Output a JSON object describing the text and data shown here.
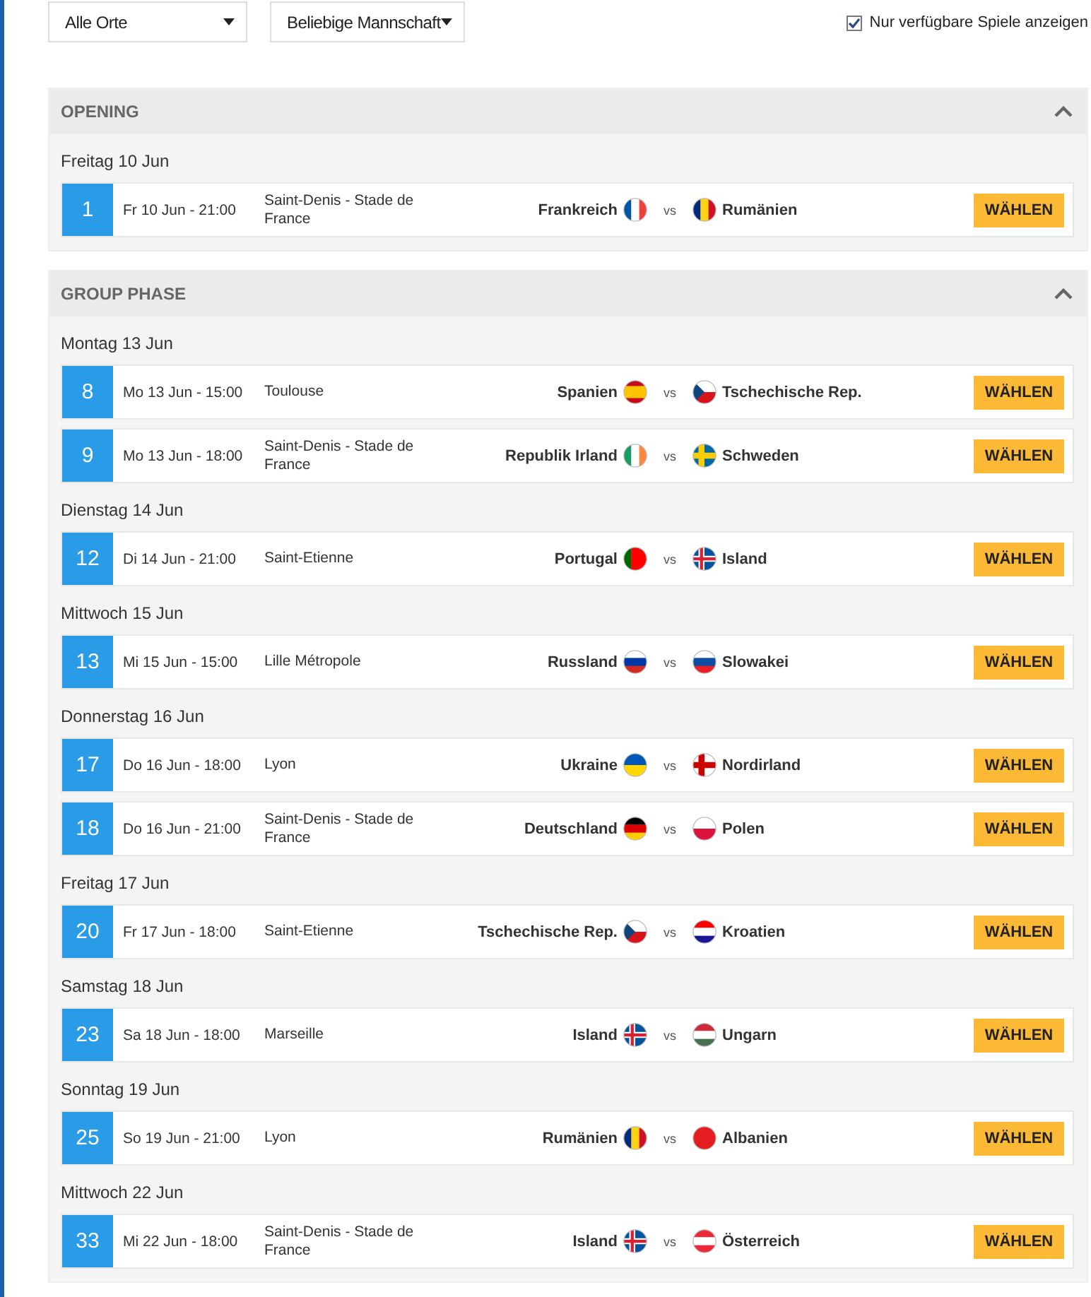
{
  "filters": {
    "dropdowns": [
      {
        "value": "Alle Orte"
      },
      {
        "value": "Beliebige Mannschaft"
      }
    ],
    "checkbox": {
      "label": "Nur verfügbare Spiele anzeigen",
      "checked": true
    }
  },
  "sections": [
    {
      "title": "OPENING",
      "expanded": true,
      "days": [
        {
          "label": "Freitag 10 Jun",
          "matches": [
            {
              "number": "1",
              "datetime": "Fr 10 Jun - 21:00",
              "venue": "Saint-Denis - Stade de France",
              "home": {
                "name": "Frankreich",
                "flag": {
                  "kind": "vertical",
                  "stripes": [
                    {
                      "color": "#0055a4"
                    },
                    {
                      "color": "#ffffff"
                    },
                    {
                      "color": "#ef4135"
                    }
                  ]
                }
              },
              "vs": "vs",
              "away": {
                "name": "Rumänien",
                "flag": {
                  "kind": "vertical",
                  "stripes": [
                    {
                      "color": "#002b7f"
                    },
                    {
                      "color": "#fcd116"
                    },
                    {
                      "color": "#ce1126"
                    }
                  ]
                }
              },
              "button": "WÄHLEN"
            }
          ]
        }
      ]
    },
    {
      "title": "GROUP PHASE",
      "expanded": true,
      "days": [
        {
          "label": "Montag 13 Jun",
          "matches": [
            {
              "number": "8",
              "datetime": "Mo 13 Jun - 15:00",
              "venue": "Toulouse",
              "home": {
                "name": "Spanien",
                "flag": {
                  "kind": "horizontal",
                  "stripes": [
                    {
                      "color": "#c60b1e"
                    },
                    {
                      "color": "#ffc400"
                    },
                    {
                      "color": "#ffc400"
                    },
                    {
                      "color": "#c60b1e"
                    }
                  ]
                }
              },
              "vs": "vs",
              "away": {
                "name": "Tschechische Rep.",
                "flag": {
                  "kind": "triangle",
                  "stripes": [
                    {
                      "color": "#ffffff"
                    },
                    {
                      "color": "#d7141a"
                    },
                    {
                      "color": "#11457e"
                    }
                  ]
                }
              },
              "button": "WÄHLEN"
            },
            {
              "number": "9",
              "datetime": "Mo 13 Jun - 18:00",
              "venue": "Saint-Denis - Stade de France",
              "home": {
                "name": "Republik Irland",
                "flag": {
                  "kind": "vertical",
                  "stripes": [
                    {
                      "color": "#169b62"
                    },
                    {
                      "color": "#ffffff"
                    },
                    {
                      "color": "#ff883e"
                    }
                  ]
                }
              },
              "vs": "vs",
              "away": {
                "name": "Schweden",
                "flag": {
                  "kind": "cross",
                  "stripes": [
                    {
                      "color": "#006aa7"
                    },
                    {
                      "color": "#fecc00"
                    },
                    {
                      "color": "#fecc00"
                    }
                  ]
                }
              },
              "button": "WÄHLEN"
            }
          ]
        },
        {
          "label": "Dienstag 14 Jun",
          "matches": [
            {
              "number": "12",
              "datetime": "Di 14 Jun - 21:00",
              "venue": "Saint-Etienne",
              "home": {
                "name": "Portugal",
                "flag": {
                  "kind": "vertical",
                  "stripes": [
                    {
                      "color": "#006600"
                    },
                    {
                      "color": "#ff0000"
                    },
                    {
                      "color": "#ff0000"
                    }
                  ]
                }
              },
              "vs": "vs",
              "away": {
                "name": "Island",
                "flag": {
                  "kind": "cross",
                  "stripes": [
                    {
                      "color": "#02529c"
                    },
                    {
                      "color": "#ffffff"
                    },
                    {
                      "color": "#dc1e35"
                    }
                  ]
                }
              },
              "button": "WÄHLEN"
            }
          ]
        },
        {
          "label": "Mittwoch 15 Jun",
          "matches": [
            {
              "number": "13",
              "datetime": "Mi 15 Jun - 15:00",
              "venue": "Lille Métropole",
              "home": {
                "name": "Russland",
                "flag": {
                  "kind": "horizontal",
                  "stripes": [
                    {
                      "color": "#ffffff"
                    },
                    {
                      "color": "#0039a6"
                    },
                    {
                      "color": "#d52b1e"
                    }
                  ]
                }
              },
              "vs": "vs",
              "away": {
                "name": "Slowakei",
                "flag": {
                  "kind": "horizontal",
                  "stripes": [
                    {
                      "color": "#ffffff"
                    },
                    {
                      "color": "#0b4ea2"
                    },
                    {
                      "color": "#ee1c25"
                    }
                  ]
                }
              },
              "button": "WÄHLEN"
            }
          ]
        },
        {
          "label": "Donnerstag 16 Jun",
          "matches": [
            {
              "number": "17",
              "datetime": "Do 16 Jun - 18:00",
              "venue": "Lyon",
              "home": {
                "name": "Ukraine",
                "flag": {
                  "kind": "horizontal",
                  "stripes": [
                    {
                      "color": "#0057b7"
                    },
                    {
                      "color": "#ffd700"
                    }
                  ]
                }
              },
              "vs": "vs",
              "away": {
                "name": "Nordirland",
                "flag": {
                  "kind": "cross",
                  "stripes": [
                    {
                      "color": "#ffffff"
                    },
                    {
                      "color": "#cc0000"
                    },
                    {
                      "color": "#cc0000"
                    }
                  ]
                }
              },
              "button": "WÄHLEN"
            },
            {
              "number": "18",
              "datetime": "Do 16 Jun - 21:00",
              "venue": "Saint-Denis - Stade de France",
              "home": {
                "name": "Deutschland",
                "flag": {
                  "kind": "horizontal",
                  "stripes": [
                    {
                      "color": "#000000"
                    },
                    {
                      "color": "#dd0000"
                    },
                    {
                      "color": "#ffce00"
                    }
                  ]
                }
              },
              "vs": "vs",
              "away": {
                "name": "Polen",
                "flag": {
                  "kind": "horizontal",
                  "stripes": [
                    {
                      "color": "#ffffff"
                    },
                    {
                      "color": "#dc143c"
                    }
                  ]
                }
              },
              "button": "WÄHLEN"
            }
          ]
        },
        {
          "label": "Freitag 17 Jun",
          "matches": [
            {
              "number": "20",
              "datetime": "Fr 17 Jun - 18:00",
              "venue": "Saint-Etienne",
              "home": {
                "name": "Tschechische Rep.",
                "flag": {
                  "kind": "triangle",
                  "stripes": [
                    {
                      "color": "#ffffff"
                    },
                    {
                      "color": "#d7141a"
                    },
                    {
                      "color": "#11457e"
                    }
                  ]
                }
              },
              "vs": "vs",
              "away": {
                "name": "Kroatien",
                "flag": {
                  "kind": "horizontal",
                  "stripes": [
                    {
                      "color": "#ff0000"
                    },
                    {
                      "color": "#ffffff"
                    },
                    {
                      "color": "#171796"
                    }
                  ]
                }
              },
              "button": "WÄHLEN"
            }
          ]
        },
        {
          "label": "Samstag 18 Jun",
          "matches": [
            {
              "number": "23",
              "datetime": "Sa 18 Jun - 18:00",
              "venue": "Marseille",
              "home": {
                "name": "Island",
                "flag": {
                  "kind": "cross",
                  "stripes": [
                    {
                      "color": "#02529c"
                    },
                    {
                      "color": "#ffffff"
                    },
                    {
                      "color": "#dc1e35"
                    }
                  ]
                }
              },
              "vs": "vs",
              "away": {
                "name": "Ungarn",
                "flag": {
                  "kind": "horizontal",
                  "stripes": [
                    {
                      "color": "#ce2939"
                    },
                    {
                      "color": "#ffffff"
                    },
                    {
                      "color": "#477050"
                    }
                  ]
                }
              },
              "button": "WÄHLEN"
            }
          ]
        },
        {
          "label": "Sonntag 19 Jun",
          "matches": [
            {
              "number": "25",
              "datetime": "So 19 Jun - 21:00",
              "venue": "Lyon",
              "home": {
                "name": "Rumänien",
                "flag": {
                  "kind": "vertical",
                  "stripes": [
                    {
                      "color": "#002b7f"
                    },
                    {
                      "color": "#fcd116"
                    },
                    {
                      "color": "#ce1126"
                    }
                  ]
                }
              },
              "vs": "vs",
              "away": {
                "name": "Albanien",
                "flag": {
                  "kind": "horizontal",
                  "stripes": [
                    {
                      "color": "#e41e20"
                    }
                  ]
                }
              },
              "button": "WÄHLEN"
            }
          ]
        },
        {
          "label": "Mittwoch 22 Jun",
          "matches": [
            {
              "number": "33",
              "datetime": "Mi 22 Jun - 18:00",
              "venue": "Saint-Denis - Stade de France",
              "home": {
                "name": "Island",
                "flag": {
                  "kind": "cross",
                  "stripes": [
                    {
                      "color": "#02529c"
                    },
                    {
                      "color": "#ffffff"
                    },
                    {
                      "color": "#dc1e35"
                    }
                  ]
                }
              },
              "vs": "vs",
              "away": {
                "name": "Österreich",
                "flag": {
                  "kind": "horizontal",
                  "stripes": [
                    {
                      "color": "#ed2939"
                    },
                    {
                      "color": "#ffffff"
                    },
                    {
                      "color": "#ed2939"
                    }
                  ]
                }
              },
              "button": "WÄHLEN"
            }
          ]
        }
      ]
    }
  ]
}
